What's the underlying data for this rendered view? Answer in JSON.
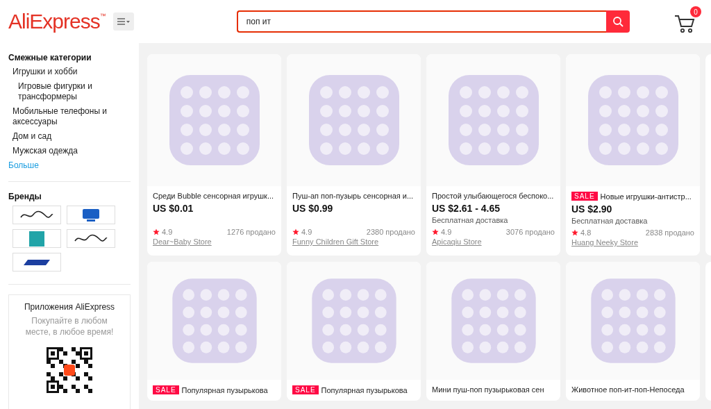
{
  "header": {
    "logo": "AliExpress",
    "logo_mark": "™",
    "search": {
      "value": "поп ит"
    },
    "cart_count": "0"
  },
  "sidebar": {
    "categories_title": "Смежные категории",
    "categories": [
      {
        "label": "Игрушки и хобби",
        "children": [
          {
            "label": "Игровые фигурки и трансформеры"
          }
        ]
      },
      {
        "label": "Мобильные телефоны и аксессуары"
      },
      {
        "label": "Дом и сад"
      },
      {
        "label": "Мужская одежда"
      }
    ],
    "more": "Больше",
    "brands_title": "Бренды",
    "brands": [
      {
        "kind": "script"
      },
      {
        "kind": "badge"
      },
      {
        "kind": "square"
      },
      {
        "kind": "script"
      },
      {
        "kind": "stripe"
      }
    ],
    "app": {
      "title": "Приложения AliExpress",
      "subtitle": "Покупайте в любом месте, в любое время!"
    }
  },
  "products": [
    {
      "title": "Среди Bubble сенсорная игрушк...",
      "sale": false,
      "price": "US $0.01",
      "rating": "4.9",
      "sold": "1276 продано",
      "store": "Dear~Baby Store"
    },
    {
      "title": "Пуш-ап поп-пузырь сенсорная и...",
      "sale": false,
      "price": "US $0.99",
      "rating": "4.9",
      "sold": "2380 продано",
      "store": "Funny Children Gift Store"
    },
    {
      "title": "Простой улыбающегося беспоко...",
      "sale": false,
      "price": "US $2.61 - 4.65",
      "shipping": "Бесплатная доставка",
      "rating": "4.9",
      "sold": "3076 продано",
      "store": "Apicaqiu Store"
    },
    {
      "title": "Новые игрушки-антистр...",
      "sale": true,
      "sale_label": "SALE",
      "price": "US $2.90",
      "shipping": "Бесплатная доставка",
      "rating": "4.8",
      "sold": "2838 продано",
      "store": "Huang Neeky Store"
    },
    {
      "title": "Популярная пузырькова",
      "sale": true,
      "sale_label": "SALE"
    },
    {
      "title": "Популярная пузырькова",
      "sale": true,
      "sale_label": "SALE"
    },
    {
      "title": "Мини пуш-поп пузырьковая сен",
      "sale": false
    },
    {
      "title": "Животное поп-ит-поп-Непоседа",
      "sale": false
    }
  ]
}
